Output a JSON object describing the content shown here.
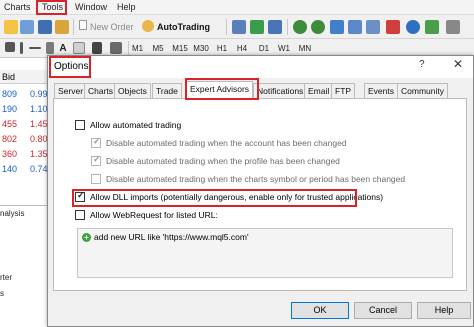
{
  "menu": {
    "items": [
      "Charts",
      "Tools",
      "Window",
      "Help"
    ],
    "highlighted": "Tools",
    "highlight_color": "#d8232a"
  },
  "toolbar": {
    "new_order_label": "New Order",
    "autotrading_label": "AutoTrading",
    "timeframes": [
      "M1",
      "M5",
      "M15",
      "M30",
      "H1",
      "H4",
      "D1",
      "W1",
      "MN"
    ]
  },
  "market_watch": {
    "header": "Bid",
    "rows": [
      {
        "bid": "809",
        "ask": "0.99",
        "color": "#1a5fd0"
      },
      {
        "bid": "190",
        "ask": "1.10",
        "color": "#1a5fd0"
      },
      {
        "bid": "455",
        "ask": "1.45",
        "color": "#d8232a"
      },
      {
        "bid": "802",
        "ask": "0.80",
        "color": "#d8232a"
      },
      {
        "bid": "360",
        "ask": "1.35",
        "color": "#d8232a"
      },
      {
        "bid": "140",
        "ask": "0.74",
        "color": "#1a5fd0"
      }
    ],
    "bottom_labels": [
      "nalysis",
      "rter",
      "s"
    ]
  },
  "dialog": {
    "title": "Options",
    "help_symbol": "?",
    "close_symbol": "✕",
    "tabs": [
      "Server",
      "Charts",
      "Objects",
      "Trade",
      "Expert Advisors",
      "Notifications",
      "Email",
      "FTP",
      "Events",
      "Community"
    ],
    "active_tab": "Expert Advisors",
    "options": {
      "allow_automated_trading": {
        "label": "Allow automated trading",
        "checked": false
      },
      "disable_account_changed": {
        "label": "Disable automated trading when the account has been changed",
        "checked": true,
        "disabled": true
      },
      "disable_profile_changed": {
        "label": "Disable automated trading when the profile has been changed",
        "checked": true,
        "disabled": true
      },
      "disable_symbol_changed": {
        "label": "Disable automated trading when the charts symbol or period has been changed",
        "checked": false,
        "disabled": true
      },
      "allow_dll_imports": {
        "label": "Allow DLL imports (potentially dangerous, enable only for trusted applications)",
        "checked": true
      },
      "allow_webrequest": {
        "label": "Allow WebRequest for listed URL:",
        "checked": false
      }
    },
    "url_list": {
      "add_item": "add new URL like 'https://www.mql5.com'"
    },
    "buttons": {
      "ok": "OK",
      "cancel": "Cancel",
      "help": "Help"
    }
  }
}
